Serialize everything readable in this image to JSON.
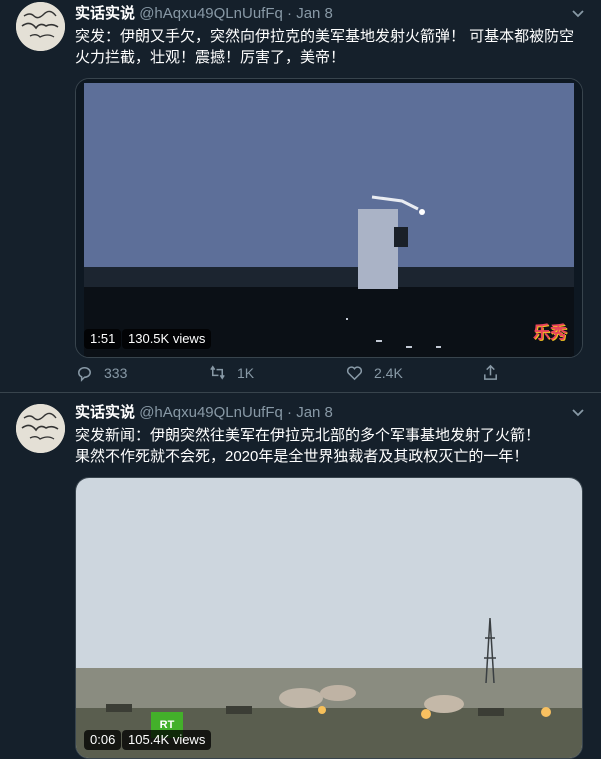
{
  "tweets": [
    {
      "name": "实话实说",
      "handle": "@hAqxu49QLnUufFq",
      "dot": "·",
      "date": "Jan 8",
      "text_line1": "突发：伊朗又手欠，突然向伊拉克的美军基地发射火箭弹！ 可基本都被防空",
      "text_line2": "火力拦截，壮观！震撼！厉害了，美帝！",
      "video": {
        "duration": "1:51",
        "views": "130.5K views",
        "watermark": "乐秀"
      },
      "actions": {
        "replies": "333",
        "retweets": "1K",
        "likes": "2.4K"
      }
    },
    {
      "name": "实话实说",
      "handle": "@hAqxu49QLnUufFq",
      "dot": "·",
      "date": "Jan 8",
      "text_line1": "突发新闻：伊朗突然往美军在伊拉克北部的多个军事基地发射了火箭！",
      "text_line2": "果然不作死就不会死，2020年是全世界独裁者及其政权灭亡的一年！",
      "video": {
        "duration": "0:06",
        "views": "105.4K views",
        "logo": "RT"
      }
    }
  ]
}
